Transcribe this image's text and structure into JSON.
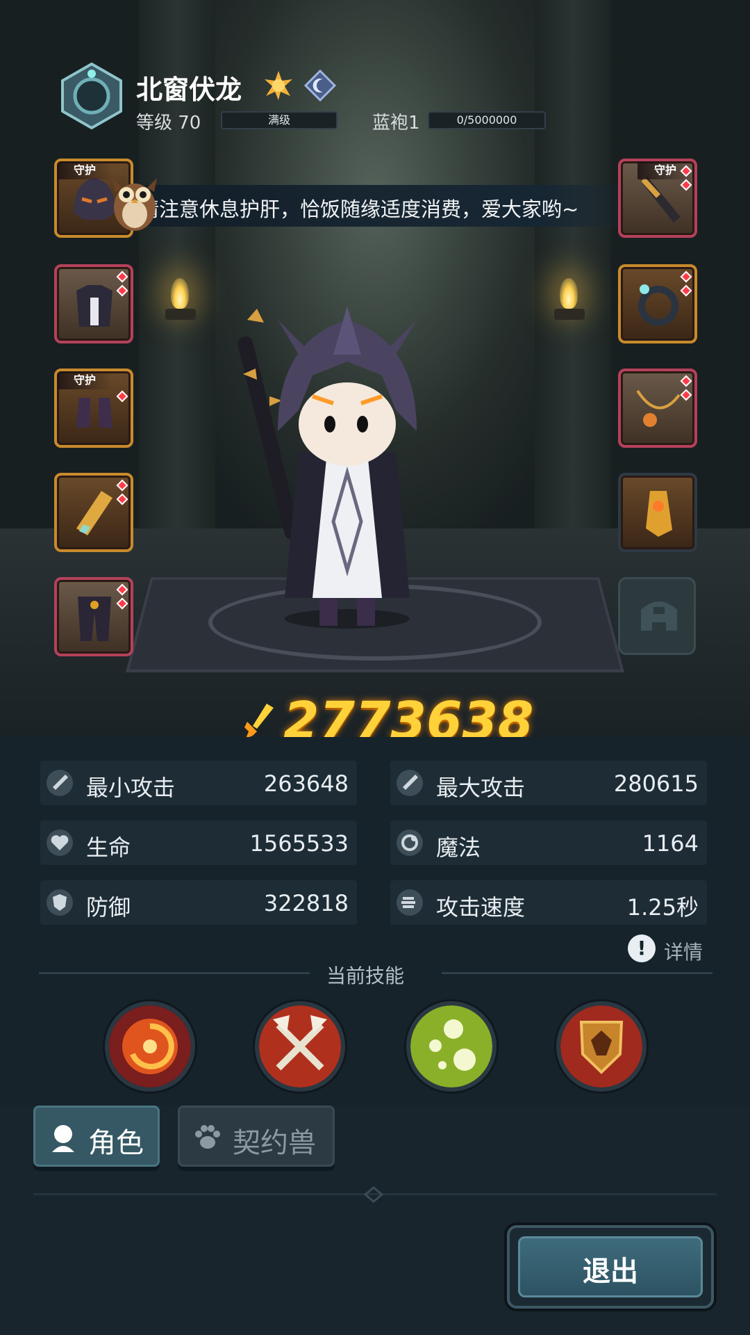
{
  "player": {
    "name": "北窗伏龙",
    "level_label": "等级 70",
    "level_status": "满级",
    "rank_label": "蓝袍1",
    "rank_progress_text": "0/5000000"
  },
  "notice": {
    "text": "请注意休息护肝，恰饭随缘适度消费，爱大家哟~"
  },
  "equipment": {
    "guard_tag": "守护",
    "left_slots": [
      "helmet",
      "armor",
      "boots",
      "bracer",
      "pants"
    ],
    "right_slots": [
      "weapon",
      "ring",
      "necklace",
      "glove",
      "locked"
    ]
  },
  "power": {
    "value": "2773638"
  },
  "stats": {
    "min_attack": {
      "label": "最小攻击",
      "value": "263648"
    },
    "max_attack": {
      "label": "最大攻击",
      "value": "280615"
    },
    "hp": {
      "label": "生命",
      "value": "1565533"
    },
    "mp": {
      "label": "魔法",
      "value": "1164"
    },
    "defense": {
      "label": "防御",
      "value": "322818"
    },
    "attack_speed": {
      "label": "攻击速度",
      "value": "1.25秒"
    }
  },
  "details_label": "详情",
  "skills": {
    "title": "当前技能",
    "items": [
      "fire-vortex-icon",
      "crossed-axes-icon",
      "green-orbs-icon",
      "guild-shield-icon"
    ]
  },
  "tabs": {
    "role": "角色",
    "pet": "契约兽"
  },
  "exit_label": "退出",
  "colors": {
    "power": "#ffd23a",
    "gem": "#ff3b4a",
    "panel": "#16232b"
  }
}
